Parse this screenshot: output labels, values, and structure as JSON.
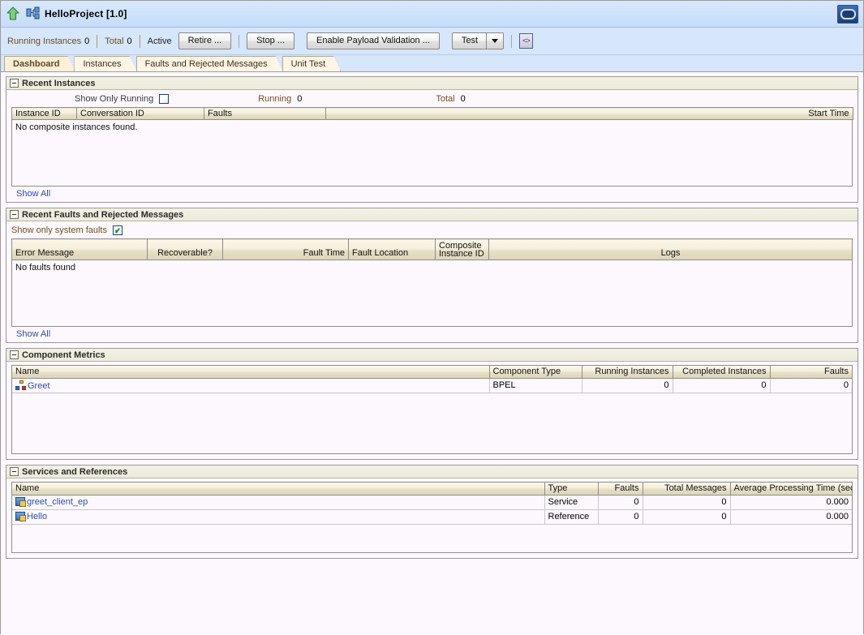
{
  "window": {
    "title": "HelloProject [1.0]",
    "home_icon": "up-arrow-icon",
    "composite_icon": "composite-icon",
    "monitor_icon": "monitor-icon"
  },
  "toolbar": {
    "running_instances_label": "Running Instances",
    "running_instances_value": "0",
    "total_label": "Total",
    "total_value": "0",
    "state_label": "Active",
    "retire_button": "Retire ...",
    "stop_button": "Stop ...",
    "payload_validation_button": "Enable Payload Validation ...",
    "test_button": "Test",
    "dropdown_icon": "chevron-down-icon",
    "code_button_icon": "code-icon"
  },
  "tabs": [
    {
      "label": "Dashboard",
      "active": true
    },
    {
      "label": "Instances",
      "active": false
    },
    {
      "label": "Faults and Rejected Messages",
      "active": false
    },
    {
      "label": "Unit Test",
      "active": false
    }
  ],
  "recent_instances": {
    "title": "Recent Instances",
    "collapse_icon": "collapse-minus-icon",
    "show_only_running_label": "Show Only Running",
    "show_only_running_checked": false,
    "running_label": "Running",
    "running_value": "0",
    "total_label": "Total",
    "total_value": "0",
    "columns": [
      "Instance ID",
      "Conversation ID",
      "Faults",
      "",
      "Start Time"
    ],
    "empty_message": "No composite instances found.",
    "show_all_link": "Show All"
  },
  "recent_faults": {
    "title": "Recent Faults and Rejected Messages",
    "collapse_icon": "collapse-minus-icon",
    "show_only_system_faults_label": "Show only system faults",
    "show_only_system_faults_checked": true,
    "columns": [
      "Error Message",
      "Recoverable?",
      "Fault Time",
      "Fault Location",
      "Composite Instance ID",
      "Logs"
    ],
    "empty_message": "No faults found",
    "show_all_link": "Show All"
  },
  "component_metrics": {
    "title": "Component Metrics",
    "collapse_icon": "collapse-minus-icon",
    "columns": [
      "Name",
      "Component Type",
      "Running Instances",
      "Completed Instances",
      "Faults"
    ],
    "rows": [
      {
        "icon": "component-icon",
        "name": "Greet",
        "component_type": "BPEL",
        "running_instances": "0",
        "completed_instances": "0",
        "faults": "0"
      }
    ]
  },
  "services_references": {
    "title": "Services and References",
    "collapse_icon": "collapse-minus-icon",
    "columns": [
      "Name",
      "Type",
      "Faults",
      "Total Messages",
      "Average Processing Time (sec)"
    ],
    "rows": [
      {
        "icon": "service-icon",
        "name": "greet_client_ep",
        "type": "Service",
        "faults": "0",
        "total_messages": "0",
        "avg_processing_time": "0.000"
      },
      {
        "icon": "reference-icon",
        "name": "Hello",
        "type": "Reference",
        "faults": "0",
        "total_messages": "0",
        "avg_processing_time": "0.000"
      }
    ]
  },
  "colors": {
    "titlebar": "#cfe2fa",
    "toolbar": "#d6e6fb",
    "panel_bg": "#fdf8fd",
    "header_grad": "#f4eedc",
    "link": "#2b4f9e",
    "label_brown": "#6b4f1d",
    "check_green": "#1a8f1a"
  }
}
